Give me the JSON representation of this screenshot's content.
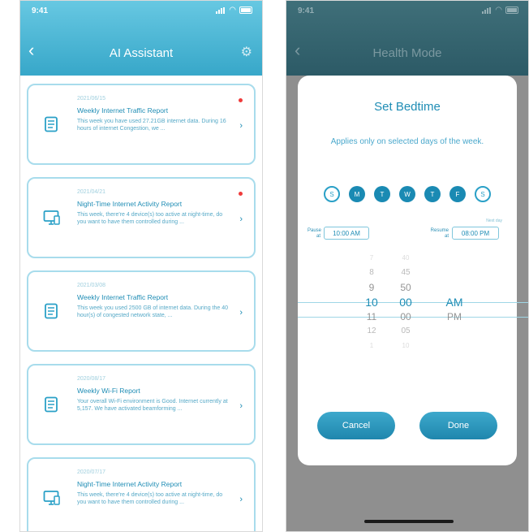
{
  "left": {
    "status": {
      "time": "9:41"
    },
    "header": {
      "title": "AI Assistant",
      "back_icon": "chevron-left-icon",
      "settings_icon": "gear-icon"
    },
    "reports": [
      {
        "date": "2021/06/15",
        "title": "Weekly Internet Traffic Report",
        "desc": "This week you have used 27.21GB internet data. During 16 hours of internet Congestion, we ...",
        "unread": true,
        "icon": "document-icon"
      },
      {
        "date": "2021/04/21",
        "title": "Night-Time Internet Activity Report",
        "desc": "This week, there're 4 device(s) too active at night-time, do you want to have them controlled during ...",
        "unread": true,
        "icon": "monitor-icon"
      },
      {
        "date": "2021/03/08",
        "title": "Weekly Internet Traffic Report",
        "desc": "This week you used 2500 GB of internet data. During the 40 hour(s) of congested network state, ...",
        "unread": false,
        "icon": "document-icon"
      },
      {
        "date": "2020/08/17",
        "title": "Weekly Wi-Fi Report",
        "desc": "Your overall Wi-Fi environment is Good. Internet currently at 5,157. We have activated beamforming ...",
        "unread": false,
        "icon": "document-icon"
      },
      {
        "date": "2020/07/17",
        "title": "Night-Time Internet Activity Report",
        "desc": "This week, there're 4 device(s) too active at night-time, do you want to have them controlled during ...",
        "unread": false,
        "icon": "monitor-icon"
      }
    ]
  },
  "right": {
    "status": {
      "time": "9:41"
    },
    "header": {
      "title": "Health Mode",
      "back_icon": "chevron-left-icon"
    },
    "modal": {
      "title": "Set Bedtime",
      "subtitle": "Applies only on selected days of the week.",
      "days": [
        {
          "label": "S",
          "selected": false
        },
        {
          "label": "M",
          "selected": true
        },
        {
          "label": "T",
          "selected": true
        },
        {
          "label": "W",
          "selected": true
        },
        {
          "label": "T",
          "selected": true
        },
        {
          "label": "F",
          "selected": true
        },
        {
          "label": "S",
          "selected": false
        }
      ],
      "pause_label": "Pause at",
      "pause_time": "10:00 AM",
      "resume_label": "Resume at",
      "resume_time": "08:00 PM",
      "next_day_label": "Next day",
      "picker": {
        "hours": [
          "7",
          "8",
          "9",
          "10",
          "11",
          "12",
          "1"
        ],
        "minutes": [
          "40",
          "45",
          "50",
          "00",
          "00",
          "05",
          "10"
        ],
        "ampm": [
          "",
          "",
          "",
          "AM",
          "PM",
          "",
          ""
        ],
        "selected_index": 3
      },
      "cancel_label": "Cancel",
      "done_label": "Done"
    }
  }
}
